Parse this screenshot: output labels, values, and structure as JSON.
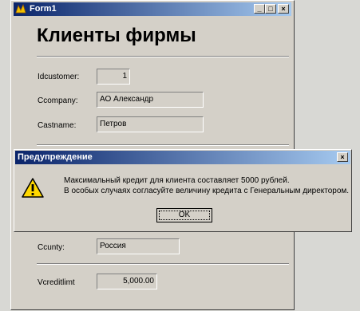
{
  "window": {
    "title": "Form1",
    "minimize_label": "_",
    "maximize_label": "□",
    "close_label": "×"
  },
  "form": {
    "heading": "Клиенты фирмы",
    "fields": {
      "idcustomer": {
        "label": "Idcustomer:",
        "value": "1"
      },
      "company": {
        "label": "Ccompany:",
        "value": "АО Александр"
      },
      "lastname": {
        "label": "Castname:",
        "value": "Петров"
      },
      "country": {
        "label": "Ccunty:",
        "value": "Россия"
      },
      "creditlimit": {
        "label": "Vcreditlimt",
        "value": "5,000.00"
      }
    }
  },
  "dialog": {
    "title": "Предупреждение",
    "close_label": "×",
    "message_line1": "Максимальный кредит для клиента составляет 5000 рублей.",
    "message_line2": "В особых случаях согласуйте величину кредита с Генеральным директором.",
    "ok_label": "OK",
    "icon": "warning-icon"
  }
}
